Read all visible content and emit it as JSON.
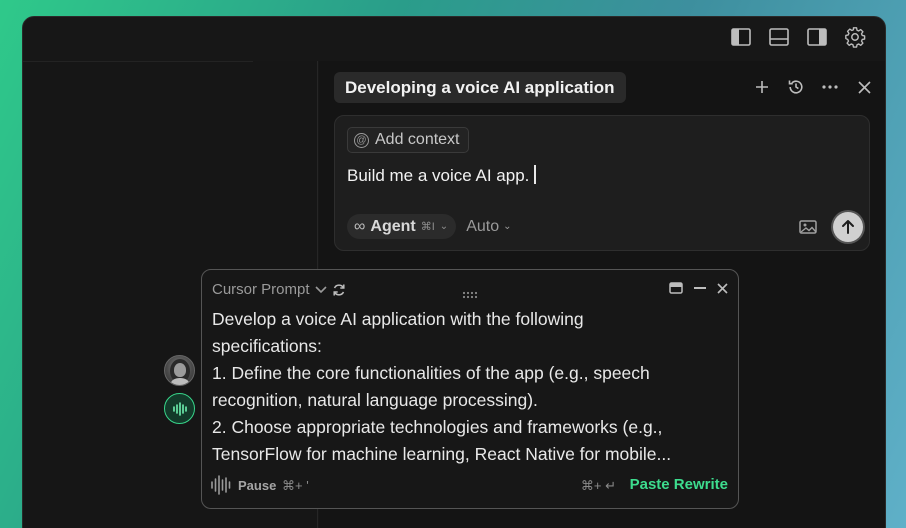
{
  "window": {
    "toolbar_icons": [
      "toggle-left-sidebar-icon",
      "toggle-bottom-panel-icon",
      "toggle-right-sidebar-icon",
      "gear-icon"
    ]
  },
  "chat": {
    "title": "Developing a voice AI application",
    "actions": [
      "plus-icon",
      "history-icon",
      "more-icon",
      "close-icon"
    ],
    "composer": {
      "context_chip": "Add context",
      "context_chip_icon": "at-icon",
      "text": "Build me a voice AI app.",
      "mode_label": "Agent",
      "mode_shortcut": "⌘I",
      "model_label": "Auto"
    }
  },
  "prompt_panel": {
    "title": "Cursor Prompt",
    "lines": [
      "Develop a voice AI application with the following",
      "specifications:",
      "1. Define the core functionalities of the app (e.g., speech",
      "recognition, natural language processing).",
      "2. Choose appropriate technologies and frameworks (e.g.,",
      "TensorFlow for machine learning, React Native for mobile..."
    ],
    "pause_label": "Pause",
    "pause_shortcut": "⌘+ '",
    "rewrite_shortcut": "⌘+ ↵",
    "rewrite_label": "Paste Rewrite"
  },
  "colors": {
    "accent_green": "#3ddc8e",
    "panel_bg": "#171717",
    "text_primary": "#e8e8e8"
  }
}
